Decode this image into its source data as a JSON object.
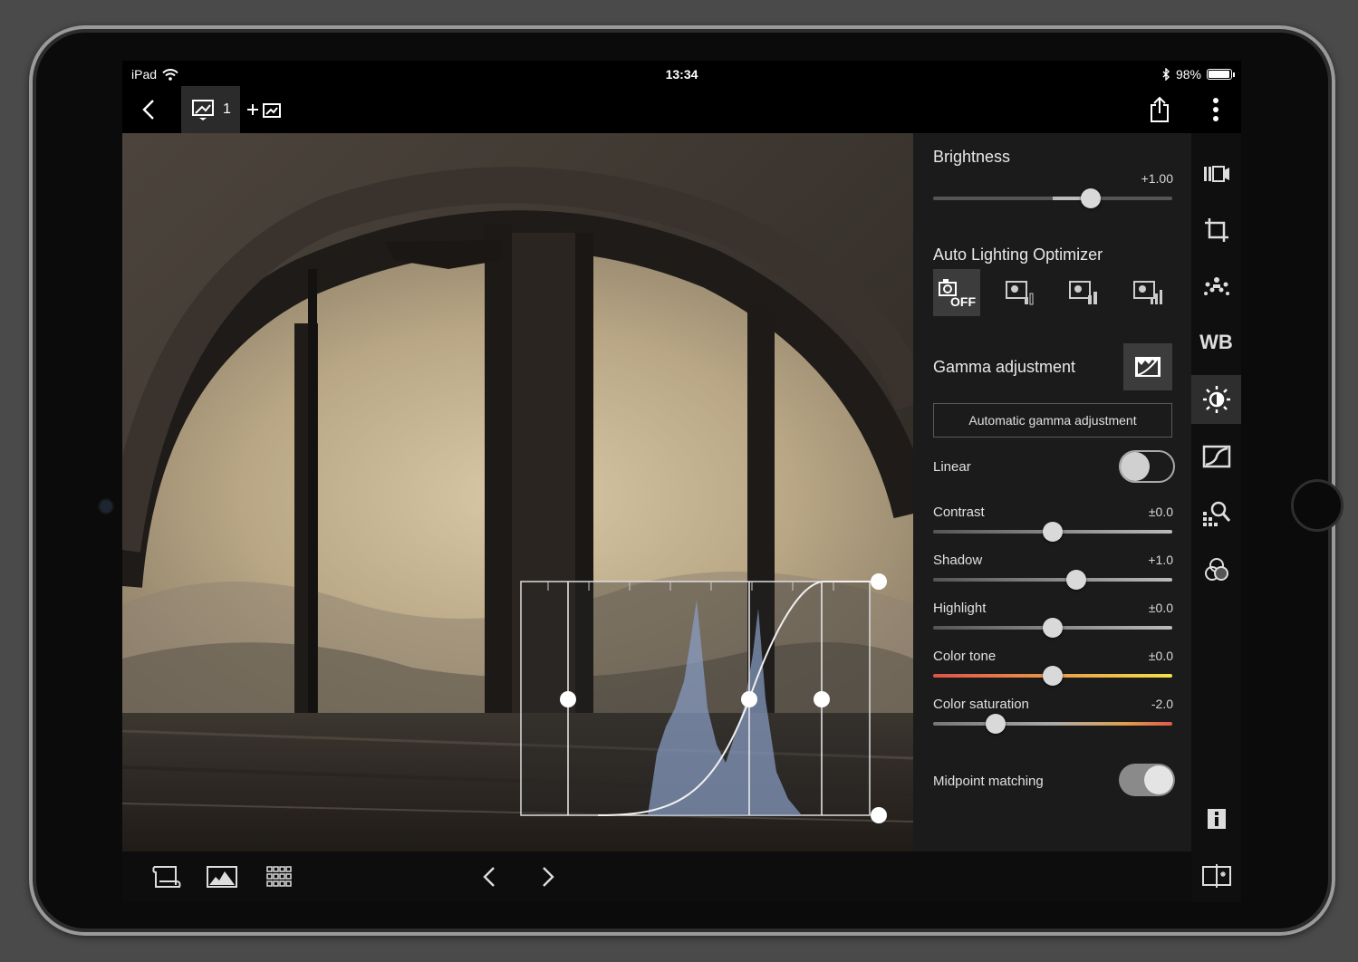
{
  "status_bar": {
    "device": "iPad",
    "time": "13:34",
    "battery": "98%"
  },
  "toolbar": {
    "image_count": "1"
  },
  "panel": {
    "brightness": {
      "title": "Brightness",
      "value": "+1.00",
      "level": 0.66
    },
    "alo": {
      "title": "Auto Lighting Optimizer",
      "options": [
        "off",
        "low",
        "standard",
        "high"
      ],
      "selected": "off"
    },
    "gamma": {
      "title": "Gamma adjustment",
      "auto_button": "Automatic gamma adjustment",
      "linear_label": "Linear",
      "linear_on": false
    },
    "contrast": {
      "label": "Contrast",
      "value": "±0.0",
      "level": 0.5
    },
    "shadow": {
      "label": "Shadow",
      "value": "+1.0",
      "level": 0.6
    },
    "highlight": {
      "label": "Highlight",
      "value": "±0.0",
      "level": 0.5
    },
    "color_tone": {
      "label": "Color tone",
      "value": "±0.0",
      "level": 0.5
    },
    "color_saturation": {
      "label": "Color saturation",
      "value": "-2.0",
      "level": 0.26
    },
    "midpoint": {
      "label": "Midpoint matching",
      "on": true
    }
  },
  "rail": {
    "wb_label": "WB"
  },
  "colors": {
    "accent_panel": "#1b1b1b",
    "tone_slider_start": "#e0524a",
    "tone_slider_end": "#f3e24a"
  }
}
